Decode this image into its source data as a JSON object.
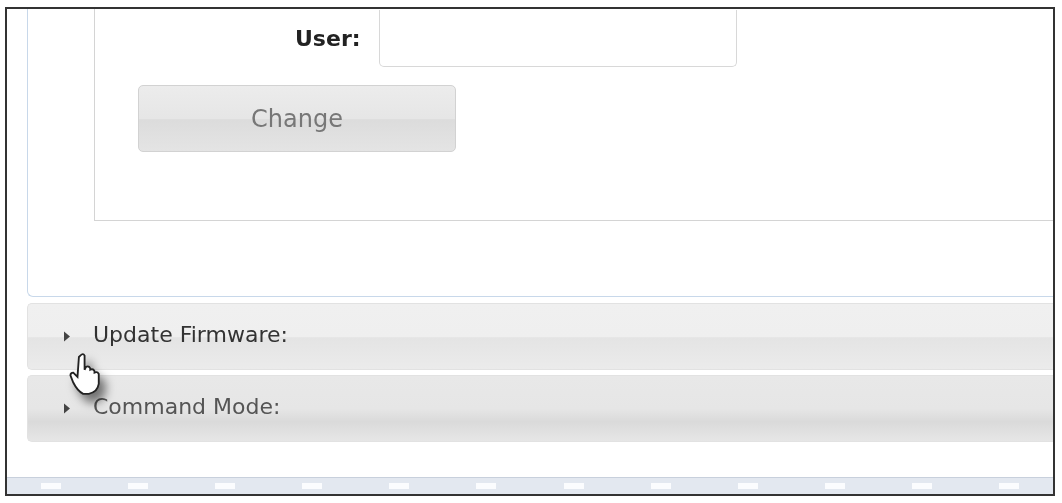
{
  "user_form": {
    "label": "User:",
    "button": "Change"
  },
  "sections": [
    {
      "title": "Update Firmware:",
      "expanded": false
    },
    {
      "title": "Command Mode:",
      "expanded": false
    }
  ]
}
